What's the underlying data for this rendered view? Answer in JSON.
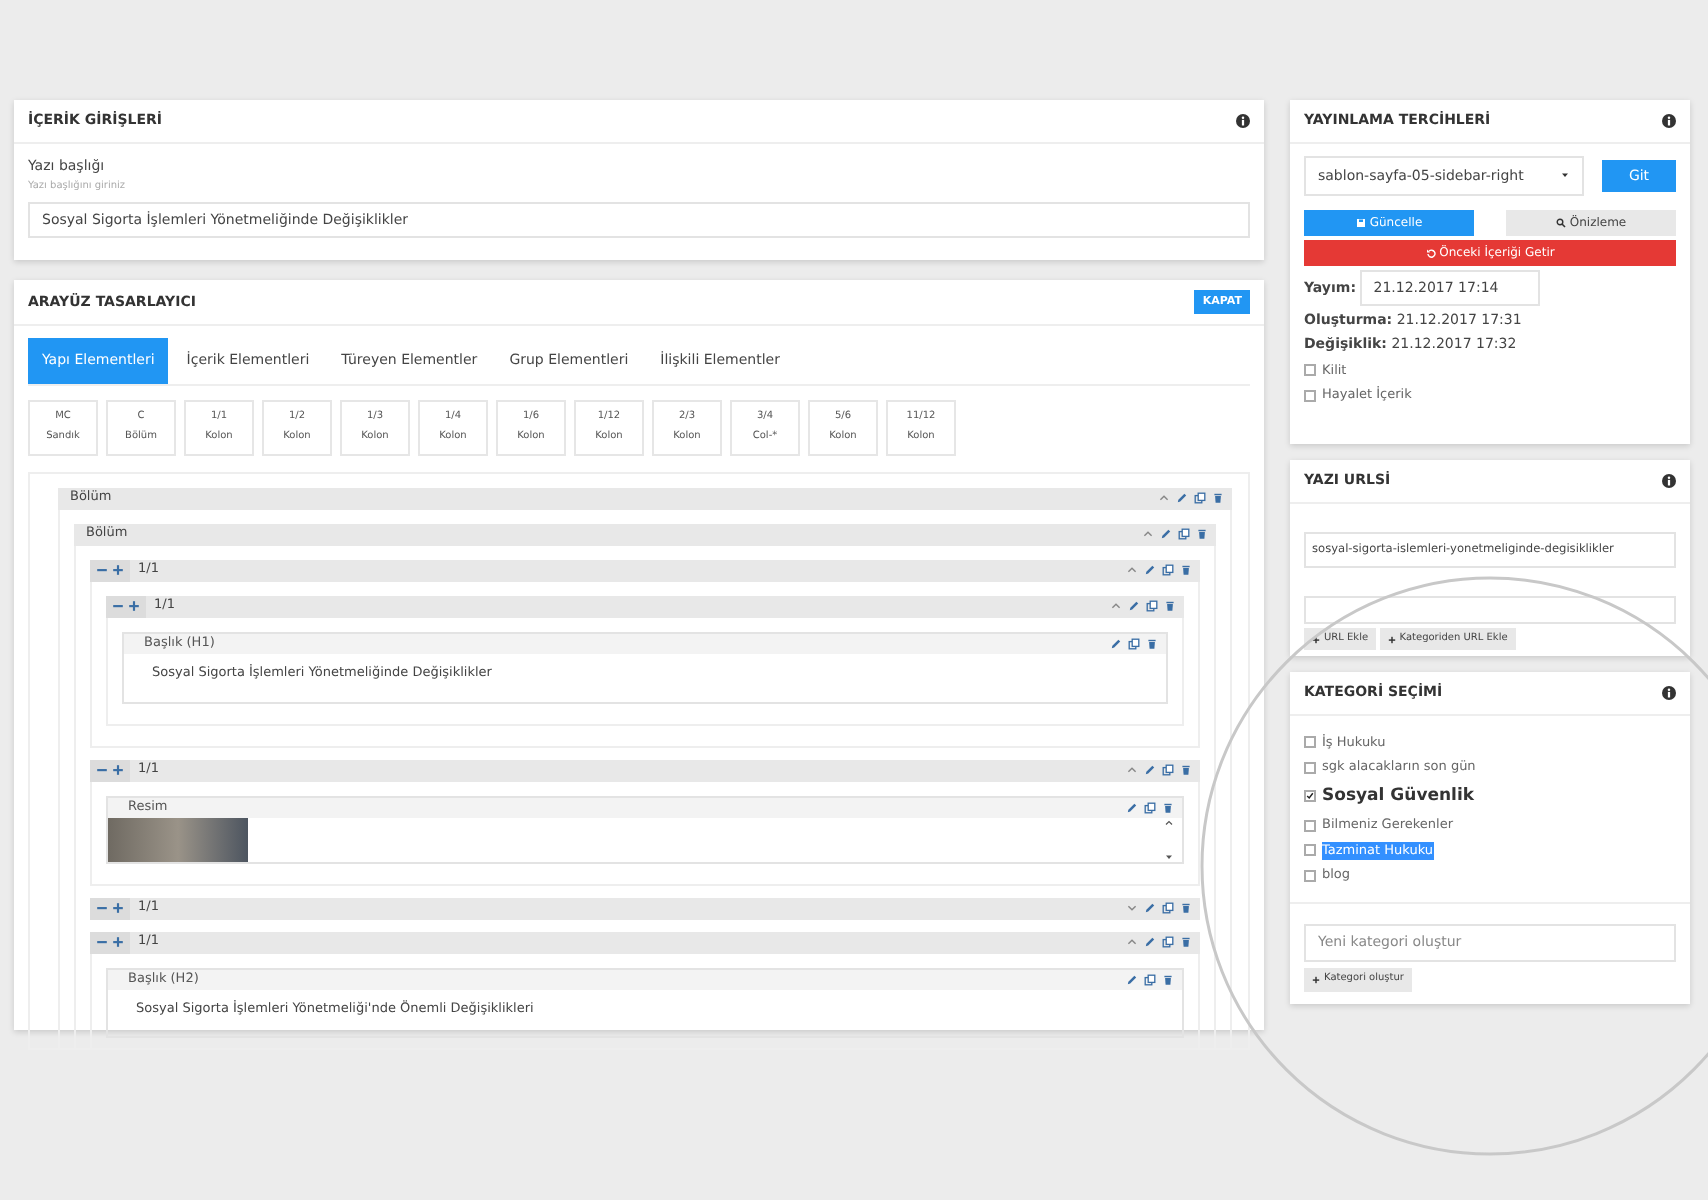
{
  "content_panel": {
    "title": "İÇERİK GİRİŞLERİ",
    "field_label": "Yazı başlığı",
    "field_hint": "Yazı başlığını giriniz",
    "title_value": "Sosyal Sigorta İşlemleri Yönetmeliğinde Değişiklikler"
  },
  "designer": {
    "title": "ARAYÜZ TASARLAYICI",
    "close_button": "KAPAT",
    "tabs": [
      {
        "label": "Yapı Elementleri",
        "selected": true
      },
      {
        "label": "İçerik Elementleri",
        "selected": false
      },
      {
        "label": "Türeyen Elementler",
        "selected": false
      },
      {
        "label": "Grup Elementleri",
        "selected": false
      },
      {
        "label": "İlişkili Elementler",
        "selected": false
      }
    ],
    "elements": [
      {
        "code": "MC",
        "label": "Sandık"
      },
      {
        "code": "C",
        "label": "Bölüm"
      },
      {
        "code": "1/1",
        "label": "Kolon"
      },
      {
        "code": "1/2",
        "label": "Kolon"
      },
      {
        "code": "1/3",
        "label": "Kolon"
      },
      {
        "code": "1/4",
        "label": "Kolon"
      },
      {
        "code": "1/6",
        "label": "Kolon"
      },
      {
        "code": "1/12",
        "label": "Kolon"
      },
      {
        "code": "2/3",
        "label": "Kolon"
      },
      {
        "code": "3/4",
        "label": "Col-*"
      },
      {
        "code": "5/6",
        "label": "Kolon"
      },
      {
        "code": "11/12",
        "label": "Kolon"
      }
    ],
    "tree": [
      {
        "kind": "section",
        "label": "Bölüm",
        "expanded": true,
        "children": [
          {
            "kind": "section",
            "label": "Bölüm",
            "expanded": true,
            "children": [
              {
                "kind": "column",
                "label": "1/1",
                "expanded": true,
                "children": [
                  {
                    "kind": "column",
                    "label": "1/1",
                    "expanded": true,
                    "children": [
                      {
                        "kind": "element",
                        "label": "Başlık (H1)",
                        "text": "Sosyal Sigorta İşlemleri Yönetmeliğinde Değişiklikler"
                      }
                    ]
                  }
                ]
              },
              {
                "kind": "column",
                "label": "1/1",
                "expanded": true,
                "children": [
                  {
                    "kind": "image",
                    "label": "Resim"
                  }
                ]
              },
              {
                "kind": "column",
                "label": "1/1",
                "expanded": false
              },
              {
                "kind": "column",
                "label": "1/1",
                "expanded": true,
                "children": [
                  {
                    "kind": "element",
                    "label": "Başlık (H2)",
                    "text": "Sosyal Sigorta İşlemleri Yönetmeliği'nde Önemli Değişiklikleri"
                  }
                ]
              }
            ]
          }
        ]
      }
    ]
  },
  "publish": {
    "title": "YAYINLAMA TERCİHLERİ",
    "template": "sablon-sayfa-05-sidebar-right",
    "go_button": "Git",
    "update_button": "Güncelle",
    "preview_button": "Önizleme",
    "restore_button": "Önceki İçeriği Getir",
    "publish_label": "Yayım:",
    "publish_value": "21.12.2017 17:14",
    "created_label": "Oluşturma:",
    "created_value": "21.12.2017 17:31",
    "modified_label": "Değişiklik:",
    "modified_value": "21.12.2017 17:32",
    "options": [
      {
        "label": "Kilit",
        "checked": false
      },
      {
        "label": "Hayalet İçerik",
        "checked": false
      }
    ]
  },
  "url_panel": {
    "title": "YAZI URLSİ",
    "url": "sosyal-sigorta-islemleri-yonetmeliginde-degisiklikler",
    "add_url_button": "URL Ekle",
    "category_url_button": "Kategoriden URL Ekle"
  },
  "category_panel": {
    "title": "KATEGORİ SEÇİMİ",
    "categories": [
      {
        "label": "İş Hukuku",
        "checked": false,
        "highlighted": false
      },
      {
        "label": "sgk alacakların son gün",
        "checked": false,
        "highlighted": false
      },
      {
        "label": "Sosyal Güvenlik",
        "checked": true,
        "highlighted": false
      },
      {
        "label": "Bilmeniz Gerekenler",
        "checked": false,
        "highlighted": false
      },
      {
        "label": "Tazminat Hukuku",
        "checked": false,
        "highlighted": true
      },
      {
        "label": "blog",
        "checked": false,
        "highlighted": false
      }
    ],
    "new_placeholder": "Yeni kategori oluştur",
    "create_button": "Kategori oluştur"
  }
}
